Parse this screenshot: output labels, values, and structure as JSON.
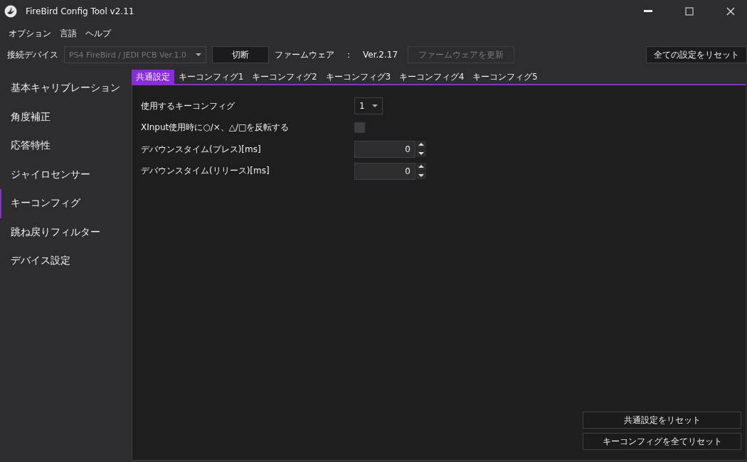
{
  "window": {
    "title": "FireBird Config Tool v2.11"
  },
  "menu": [
    "オプション",
    "言語",
    "ヘルプ"
  ],
  "toolbar": {
    "device_label": "接続デバイス",
    "device": {
      "value": "PS4 FireBird / JEDI PCB Ver.1.0",
      "disabled": true
    },
    "disconnect_button": "切断",
    "firmware_label": "ファームウェア",
    "firmware_separator": "：",
    "firmware_version": "Ver.2.17",
    "update_button": {
      "label": "ファームウェアを更新",
      "disabled": true
    },
    "reset_all_button": "全ての設定をリセット"
  },
  "sidebar": {
    "items": [
      {
        "label": "基本キャリブレーション",
        "selected": false
      },
      {
        "label": "角度補正",
        "selected": false
      },
      {
        "label": "応答特性",
        "selected": false
      },
      {
        "label": "ジャイロセンサー",
        "selected": false
      },
      {
        "label": "キーコンフィグ",
        "selected": true
      },
      {
        "label": "跳ね戻りフィルター",
        "selected": false
      },
      {
        "label": "デバイス設定",
        "selected": false
      }
    ]
  },
  "tabs": [
    {
      "label": "共通設定",
      "selected": true
    },
    {
      "label": "キーコンフィグ1",
      "selected": false
    },
    {
      "label": "キーコンフィグ2",
      "selected": false
    },
    {
      "label": "キーコンフィグ3",
      "selected": false
    },
    {
      "label": "キーコンフィグ4",
      "selected": false
    },
    {
      "label": "キーコンフィグ5",
      "selected": false
    }
  ],
  "settings": [
    {
      "kind": "dropdown",
      "label": "使用するキーコンフィグ",
      "value": "1"
    },
    {
      "kind": "checkbox",
      "label": "XInput使用時に○/×、△/□を反転する",
      "checked": false
    },
    {
      "kind": "spinner",
      "label": "デバウンスタイム(プレス)[ms]",
      "value": "0"
    },
    {
      "kind": "spinner",
      "label": "デバウンスタイム(リリース)[ms]",
      "value": "0"
    }
  ],
  "footer_buttons": [
    "共通設定をリセット",
    "キーコンフィグを全てリセット"
  ]
}
